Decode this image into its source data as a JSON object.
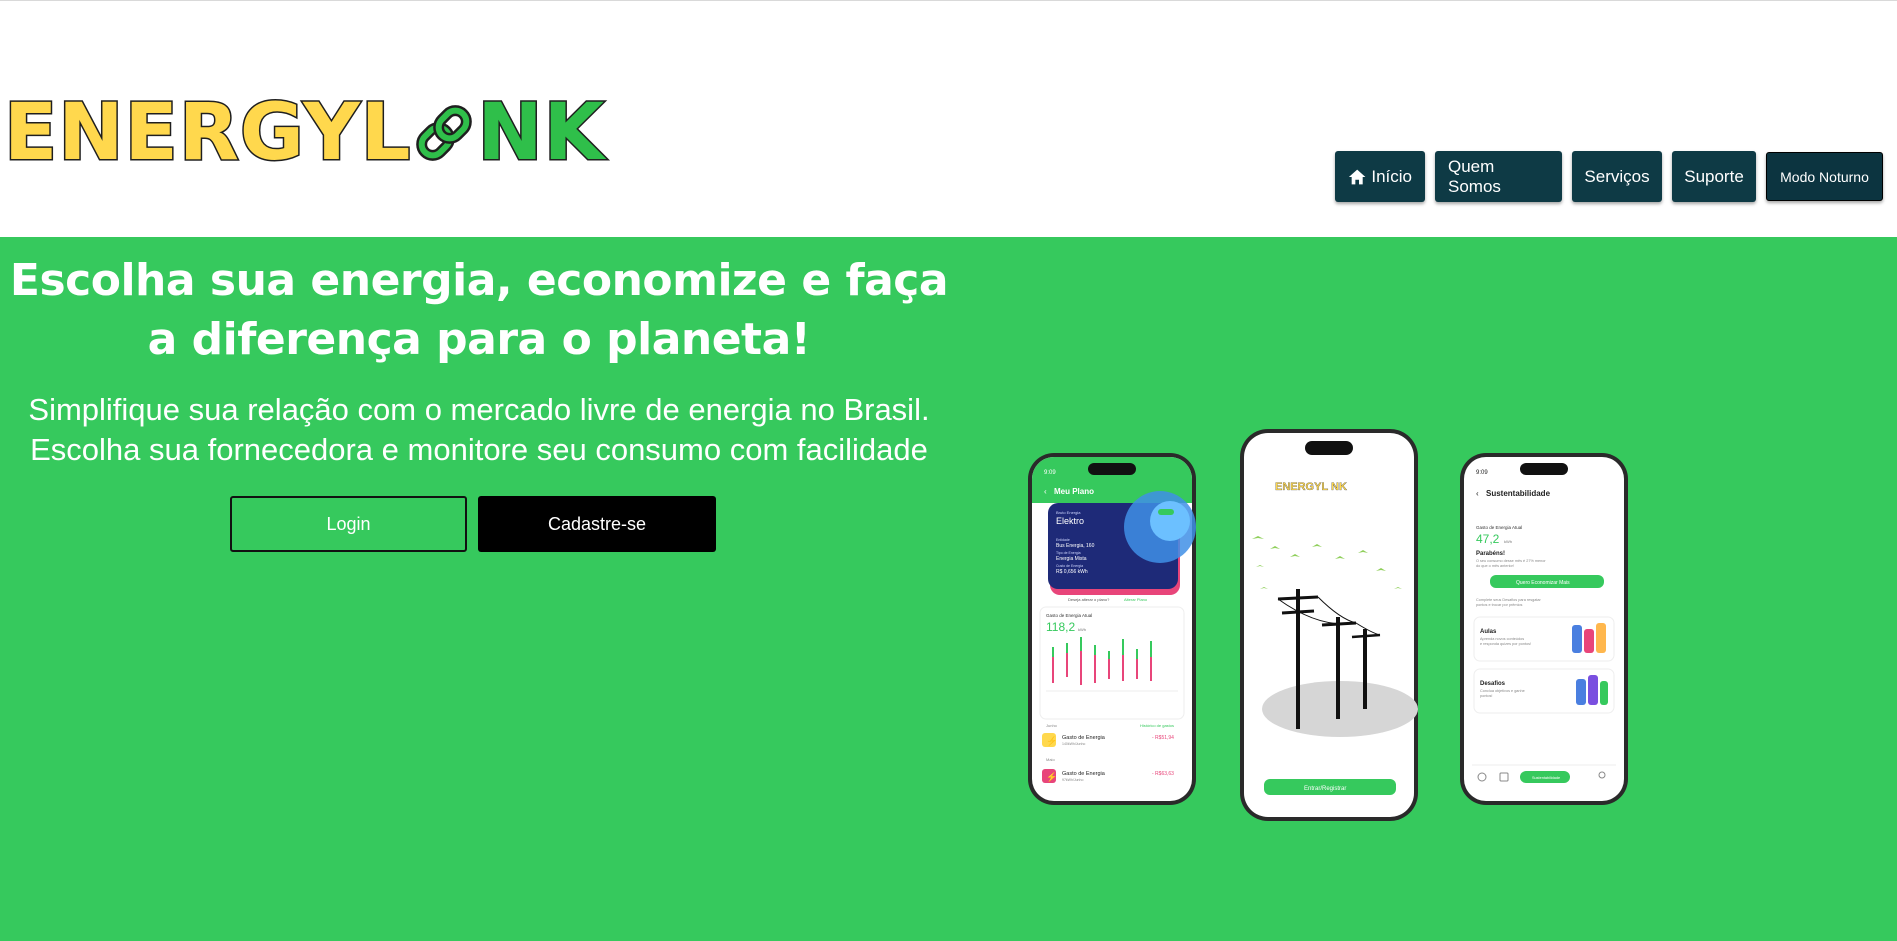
{
  "brand": {
    "logo_part1": "ENERGYL",
    "logo_part2": "NK",
    "logo_yellow": "#ffd84d",
    "logo_green": "#2fbf4a"
  },
  "nav": {
    "inicio": "Início",
    "quem_somos": "Quem Somos",
    "servicos": "Serviços",
    "suporte": "Suporte",
    "modo_noturno": "Modo Noturno",
    "color": "#0e3a45"
  },
  "hero": {
    "title": "Escolha sua energia, economize e faça a diferença para o planeta!",
    "subtitle_line1": "Simplifique sua relação com o mercado livre de energia no Brasil.",
    "subtitle_line2": "Escolha sua fornecedora e monitore seu consumo com facilidade",
    "login_label": "Login",
    "signup_label": "Cadastre-se",
    "background": "#36c95d"
  },
  "phone_left": {
    "time": "9:09",
    "header": "Meu Plano",
    "card_label": "Bruto Energia",
    "card_company": "Elektro",
    "card_line1_label": "Entidade",
    "card_line1": "Bus Energia, 160",
    "card_line2_label": "Tipo de Energia",
    "card_line2": "Energia Mista",
    "card_line3_label": "Custo de Energia",
    "card_line3": "R$ 0,656 kWh",
    "change_plan": "Deseja alterar o plano?",
    "change_plan_link": "Alterar Plano",
    "usage_label": "Gasto de Energia Atual",
    "usage_value": "118,2",
    "usage_unit": "kWh",
    "history_month1": "Junho",
    "history_link": "Histórico de gastos",
    "item1_title": "Gasto de Energia",
    "item1_sub": "140kWh/Junho",
    "item1_value": "- R$51,94",
    "history_month2": "Maio",
    "item2_title": "Gasto de Energia",
    "item2_sub": "97kWh/Junho",
    "item2_value": "- R$63,63"
  },
  "phone_center": {
    "logo": "ENERGYL NK",
    "button": "Entrar/Registrar"
  },
  "phone_right": {
    "time": "9:09",
    "header": "Sustentabilidade",
    "usage_label": "Gasto de Energia Atual",
    "usage_value": "47,2",
    "usage_unit": "kWh",
    "congrats": "Parabéns!",
    "congrats_text1": "O seu consumo desse mês é 27% menor",
    "congrats_text2": "do que o mês anterior!",
    "cta": "Quero Economizar Mais",
    "challenge_text1": "Complete seus Desafios para resgatar",
    "challenge_text2": "pontos e trocar por prêmios",
    "card1_title": "Aulas",
    "card1_text1": "Aprenda novos conteúdos",
    "card1_text2": "e responda quizes por pontos!",
    "card2_title": "Desafios",
    "card2_text1": "Conclua objetivos e ganhe",
    "card2_text2": "pontos!",
    "tab_label": "Sustentabilidade"
  }
}
